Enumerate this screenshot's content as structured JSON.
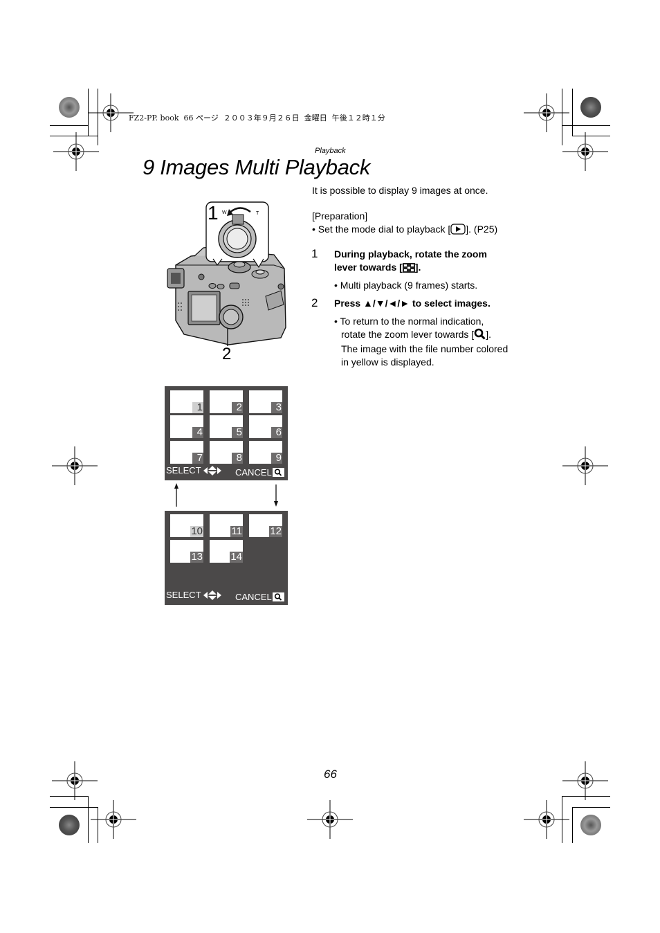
{
  "header": {
    "print_meta": "FZ2-PP. book  66 ページ  ２００３年９月２６日  金曜日  午後１２時１分",
    "section_label": "Playback",
    "page_title": "9 Images Multi Playback"
  },
  "content": {
    "intro": "It is possible to display 9 images at once.",
    "preparation_heading": "[Preparation]",
    "preparation_bullet_before": "• Set the mode dial to playback [",
    "preparation_bullet_after": "]. (P25)",
    "playback_icon": "play-icon",
    "steps": [
      {
        "number": "1",
        "text_line1": "During playback, rotate the zoom",
        "text_line2_before": "lever towards [",
        "text_line2_after": "].",
        "icon": "multi-playback-icon",
        "bullets": [
          "• Multi playback (9 frames) starts."
        ]
      },
      {
        "number": "2",
        "text": "Press ▲/▼/◄/► to select images.",
        "bullets": [
          "• To return to the normal indication,",
          "rotate the zoom lever towards [",
          "].",
          "The image with the file number colored",
          "in yellow is displayed."
        ],
        "icon": "magnify-icon"
      }
    ]
  },
  "illustration": {
    "callout_1": "1",
    "callout_2": "2",
    "lever_w": "W",
    "lever_t": "T"
  },
  "screens": [
    {
      "thumbnails": [
        "1",
        "2",
        "3",
        "4",
        "5",
        "6",
        "7",
        "8",
        "9"
      ],
      "selected": "1",
      "footer_select": "SELECT",
      "footer_cancel": "CANCEL"
    },
    {
      "thumbnails": [
        "10",
        "11",
        "12",
        "13",
        "14"
      ],
      "selected": "10",
      "footer_select": "SELECT",
      "footer_cancel": "CANCEL"
    }
  ],
  "footer": {
    "page_number": "66"
  }
}
